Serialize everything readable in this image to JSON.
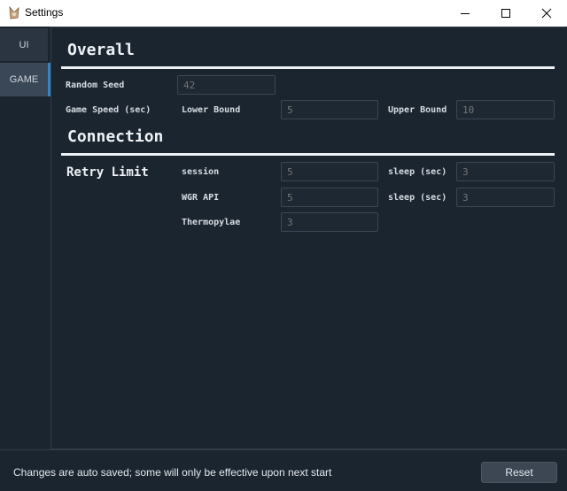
{
  "window": {
    "title": "Settings",
    "icon": "app-icon",
    "controls": [
      "minimize-icon",
      "maximize-icon",
      "close-icon"
    ]
  },
  "sidebar": {
    "tabs": [
      {
        "label": "UI",
        "active": false
      },
      {
        "label": "GAME",
        "active": true
      }
    ]
  },
  "overall": {
    "title": "Overall",
    "random_seed": {
      "label": "Random Seed",
      "placeholder": "42",
      "value": ""
    },
    "game_speed": {
      "label": "Game Speed (sec)",
      "lower_label": "Lower Bound",
      "lower_placeholder": "5",
      "upper_label": "Upper Bound",
      "upper_placeholder": "10"
    }
  },
  "connection": {
    "title": "Connection",
    "retry_label": "Retry Limit",
    "rows": [
      {
        "label": "session",
        "placeholder": "5",
        "sleep_label": "sleep (sec)",
        "sleep_placeholder": "3"
      },
      {
        "label": "WGR API",
        "placeholder": "5",
        "sleep_label": "sleep (sec)",
        "sleep_placeholder": "3"
      },
      {
        "label": "Thermopylae",
        "placeholder": "3"
      }
    ]
  },
  "status": {
    "message": "Changes are auto saved; some will only be effective upon next start",
    "reset_label": "Reset"
  },
  "colors": {
    "background": "#1b2530",
    "accent": "#2f86c7",
    "text": "#eef2f5"
  }
}
